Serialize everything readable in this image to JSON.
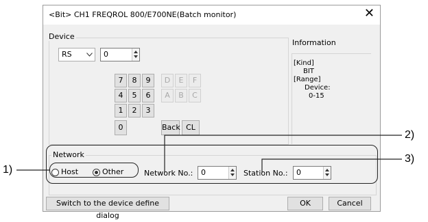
{
  "window": {
    "title": "<Bit> CH1 FREQROL 800/E700NE(Batch monitor)",
    "close_glyph": "✕"
  },
  "device": {
    "group_label": "Device",
    "type_value": "RS",
    "number_value": "0",
    "keypad": {
      "row1": [
        "7",
        "8",
        "9",
        "D",
        "E",
        "F"
      ],
      "row2": [
        "4",
        "5",
        "6",
        "A",
        "B",
        "C"
      ],
      "row3": [
        "1",
        "2",
        "3"
      ],
      "zero": "0",
      "back": "Back",
      "clear": "CL"
    }
  },
  "information": {
    "label": "Information",
    "kind_header": "[Kind]",
    "kind_value": "BIT",
    "range_header": "[Range]",
    "range_device": "Device:",
    "range_value": "0-15"
  },
  "network": {
    "group_label": "Network",
    "host_label": "Host",
    "other_label": "Other",
    "selected": "Other",
    "network_no_label": "Network No.:",
    "network_no_value": "0",
    "station_no_label": "Station No.:",
    "station_no_value": "0"
  },
  "buttons": {
    "switch": "Switch to the device define dialog",
    "ok": "OK",
    "cancel": "Cancel"
  },
  "callouts": {
    "c1": "1)",
    "c2": "2)",
    "c3": "3)"
  },
  "icons": {
    "dropdown": "chevron-down-icon",
    "spinner": "spinner-icon",
    "close": "close-icon"
  }
}
